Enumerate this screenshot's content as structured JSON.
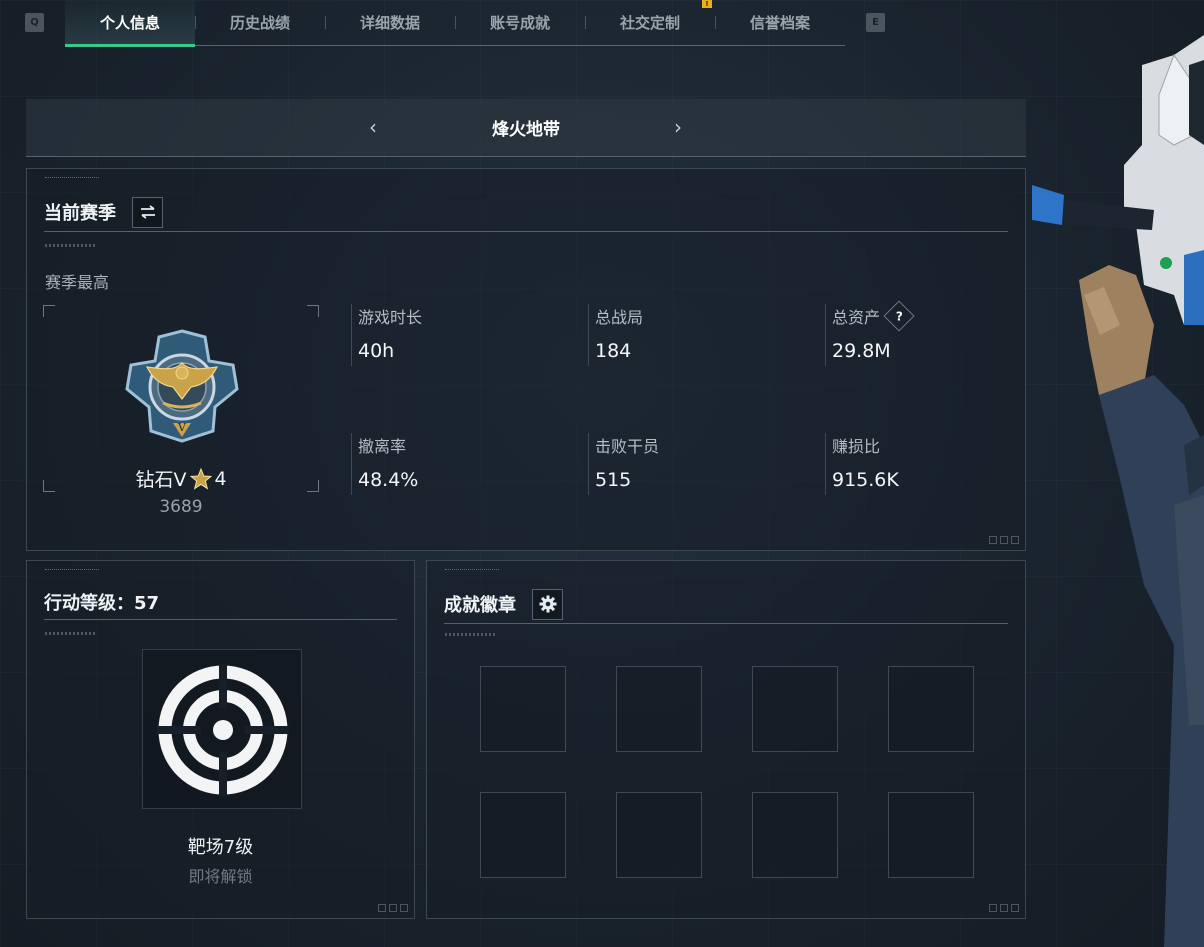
{
  "tabs": {
    "left_key": "Q",
    "right_key": "E",
    "items": [
      {
        "label": "个人信息"
      },
      {
        "label": "历史战绩"
      },
      {
        "label": "详细数据"
      },
      {
        "label": "账号成就"
      },
      {
        "label": "社交定制"
      },
      {
        "label": "信誉档案"
      }
    ],
    "active_index": 0,
    "alert_mark": "!"
  },
  "mode": {
    "title": "烽火地带",
    "prev": "‹",
    "next": "›"
  },
  "season": {
    "title": "当前赛季",
    "highest_label": "赛季最高",
    "rank_name": "钻石V",
    "rank_stars": "4",
    "rank_score": "3689",
    "stats": [
      {
        "label": "游戏时长",
        "value": "40h"
      },
      {
        "label": "总战局",
        "value": "184"
      },
      {
        "label": "总资产",
        "value": "29.8M",
        "help": "?"
      },
      {
        "label": "撤离率",
        "value": "48.4%"
      },
      {
        "label": "击败干员",
        "value": "515"
      },
      {
        "label": "赚损比",
        "value": "915.6K"
      }
    ]
  },
  "level": {
    "title": "行动等级：57",
    "badge_name": "靶场7级",
    "badge_status": "即将解锁"
  },
  "achievements": {
    "title": "成就徽章",
    "slot_count": 8
  },
  "colors": {
    "accent": "#39c98a",
    "warning": "#e8b021",
    "gold": "#c9a24a"
  }
}
